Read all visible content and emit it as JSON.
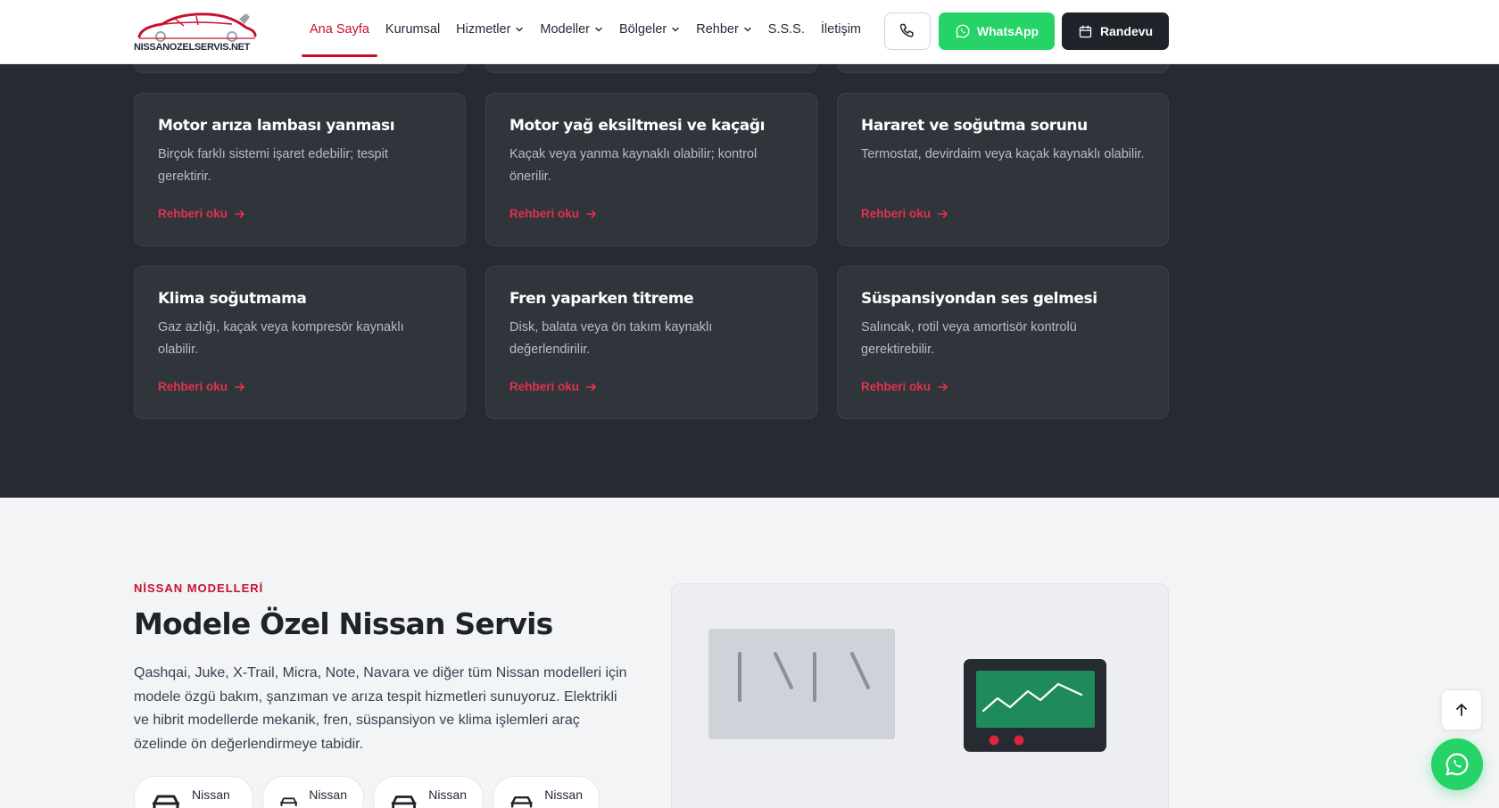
{
  "header": {
    "logo_text": "NISSANOZELSERVIS.NET",
    "nav": [
      {
        "label": "Ana Sayfa",
        "active": true,
        "dropdown": false
      },
      {
        "label": "Kurumsal",
        "active": false,
        "dropdown": false
      },
      {
        "label": "Hizmetler",
        "active": false,
        "dropdown": true
      },
      {
        "label": "Modeller",
        "active": false,
        "dropdown": true
      },
      {
        "label": "Bölgeler",
        "active": false,
        "dropdown": true
      },
      {
        "label": "Rehber",
        "active": false,
        "dropdown": true
      },
      {
        "label": "S.S.S.",
        "active": false,
        "dropdown": false
      },
      {
        "label": "İletişim",
        "active": false,
        "dropdown": false
      }
    ],
    "whatsapp_label": "WhatsApp",
    "appointment_label": "Randevu"
  },
  "guides": {
    "link_label": "Rehberi oku",
    "cards": [
      {
        "title": "Motor arıza lambası yanması",
        "desc": "Birçok farklı sistemi işaret edebilir; tespit gerektirir."
      },
      {
        "title": "Motor yağ eksiltmesi ve kaçağı",
        "desc": "Kaçak veya yanma kaynaklı olabilir; kontrol önerilir."
      },
      {
        "title": "Hararet ve soğutma sorunu",
        "desc": "Termostat, devirdaim veya kaçak kaynaklı olabilir."
      },
      {
        "title": "Klima soğutmama",
        "desc": "Gaz azlığı, kaçak veya kompresör kaynaklı olabilir."
      },
      {
        "title": "Fren yaparken titreme",
        "desc": "Disk, balata veya ön takım kaynaklı değerlendirilir."
      },
      {
        "title": "Süspansiyondan ses gelmesi",
        "desc": "Salıncak, rotil veya amortisör kontrolü gerektirebilir."
      }
    ]
  },
  "models": {
    "eyebrow": "NİSSAN MODELLERİ",
    "title": "Modele Özel Nissan Servis",
    "description": "Qashqai, Juke, X-Trail, Micra, Note, Navara ve diğer tüm Nissan modelleri için modele özgü bakım, şanzıman ve arıza tespit hizmetleri sunuyoruz. Elektrikli ve hibrit modellerde mekanik, fren, süspansiyon ve klima işlemleri araç özelinde ön değerlendirmeye tabidir.",
    "chips": [
      "Nissan",
      "Nissan",
      "Nissan",
      "Nissan"
    ]
  },
  "colors": {
    "accent": "#c8102e",
    "dark_bg": "#272a30",
    "card_bg": "#30343b",
    "whatsapp": "#25d366"
  }
}
